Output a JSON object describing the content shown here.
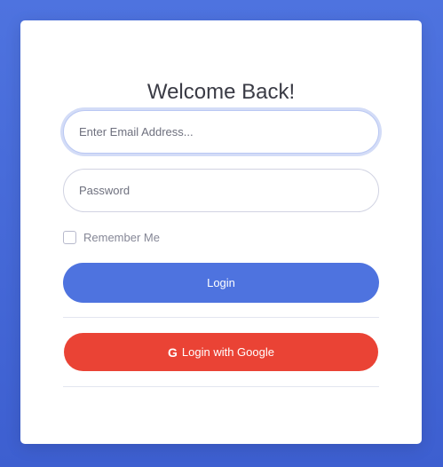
{
  "login_form": {
    "title": "Welcome Back!",
    "email_placeholder": "Enter Email Address...",
    "password_placeholder": "Password",
    "remember_label": "Remember Me",
    "login_button": "Login",
    "google_button": "Login with Google",
    "google_icon_glyph": "G"
  },
  "colors": {
    "background": "#4e73df",
    "primary": "#4e73df",
    "google": "#ea4335"
  }
}
